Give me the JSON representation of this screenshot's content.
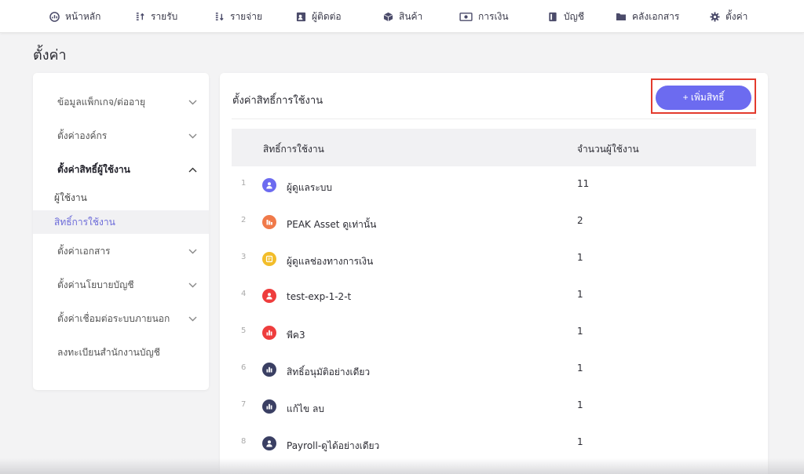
{
  "nav": {
    "items": [
      {
        "label": "หน้าหลัก",
        "icon": "dashboard-icon"
      },
      {
        "label": "รายรับ",
        "icon": "income-icon"
      },
      {
        "label": "รายจ่าย",
        "icon": "expense-icon"
      },
      {
        "label": "ผู้ติดต่อ",
        "icon": "contacts-icon"
      },
      {
        "label": "สินค้า",
        "icon": "box-icon"
      },
      {
        "label": "การเงิน",
        "icon": "money-icon"
      },
      {
        "label": "บัญชี",
        "icon": "book-icon"
      },
      {
        "label": "คลังเอกสาร",
        "icon": "folder-icon"
      },
      {
        "label": "ตั้งค่า",
        "icon": "gear-icon"
      }
    ]
  },
  "page": {
    "title": "ตั้งค่า"
  },
  "sidebar": {
    "items": [
      {
        "label": "ข้อมูลแพ็กเกจ/ต่ออายุ"
      },
      {
        "label": "ตั้งค่าองค์กร"
      },
      {
        "label": "ตั้งค่าสิทธิ์ผู้ใช้งาน"
      },
      {
        "label": "ตั้งค่าเอกสาร"
      },
      {
        "label": "ตั้งค่านโยบายบัญชี"
      },
      {
        "label": "ตั้งค่าเชื่อมต่อระบบภายนอก"
      },
      {
        "label": "ลงทะเบียนสำนักงานบัญชี"
      }
    ],
    "subitems": [
      {
        "label": "ผู้ใช้งาน"
      },
      {
        "label": "สิทธิ์การใช้งาน"
      }
    ]
  },
  "main": {
    "title": "ตั้งค่าสิทธิ์การใช้งาน",
    "add_button": "+ เพิ่มสิทธิ์",
    "columns": [
      "สิทธิ์การใช้งาน",
      "จำนวนผู้ใช้งาน"
    ],
    "rows": [
      {
        "index": "1",
        "name": "ผู้ดูแลระบบ",
        "count": "11",
        "color": "#6c6bf0"
      },
      {
        "index": "2",
        "name": "PEAK Asset ดูเท่านั้น",
        "count": "2",
        "color": "#f07a4a"
      },
      {
        "index": "3",
        "name": "ผู้ดูแลช่องทางการเงิน",
        "count": "1",
        "color": "#f2bd2a"
      },
      {
        "index": "4",
        "name": "test-exp-1-2-t",
        "count": "1",
        "color": "#ee3d3d"
      },
      {
        "index": "5",
        "name": "พีค3",
        "count": "1",
        "color": "#ee3d3d"
      },
      {
        "index": "6",
        "name": "สิทธิ์อนุมัติอย่างเดียว",
        "count": "1",
        "color": "#3a3f63"
      },
      {
        "index": "7",
        "name": "แก้ไข ลบ",
        "count": "1",
        "color": "#3a3f63"
      },
      {
        "index": "8",
        "name": "Payroll-ดูได้อย่างเดียว",
        "count": "1",
        "color": "#3a3f63"
      }
    ]
  },
  "colors": {
    "accent": "#6c6bf0",
    "highlight": "#e33b2e"
  }
}
